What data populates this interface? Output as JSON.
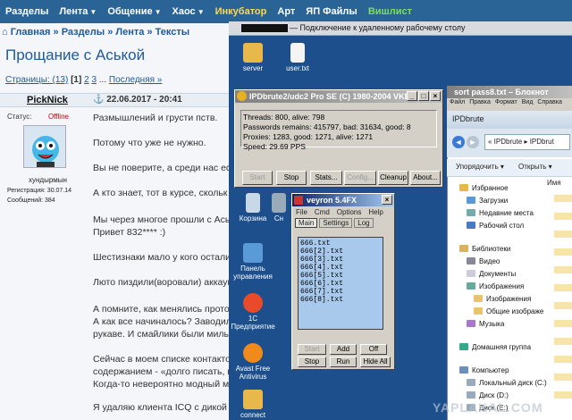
{
  "forum": {
    "nav": [
      {
        "label": "Разделы"
      },
      {
        "label": "Лента",
        "dropdown": true
      },
      {
        "label": "Общение",
        "dropdown": true
      },
      {
        "label": "Хаос",
        "dropdown": true
      },
      {
        "label": "Инкубатор"
      },
      {
        "label": "Арт"
      },
      {
        "label": "ЯП Файлы"
      },
      {
        "label": "Вишлист"
      }
    ],
    "breadcrumb": {
      "home": "Главная",
      "sep": "»",
      "items": [
        "Разделы",
        "Лента",
        "Тексты"
      ]
    },
    "title": "Прощание с Аськой",
    "pager": {
      "label": "Страницы: (13)",
      "current": "[1]",
      "pages": [
        "2",
        "3"
      ],
      "ellipsis": "...",
      "last": "Последняя »"
    },
    "post": {
      "author": "PickNick",
      "date": "22.06.2017 - 20:41",
      "status_label": "Статус:",
      "status_value": "Offline",
      "avatar_name": "хундырмын",
      "registered": "Регистрация: 30.07.14",
      "messages": "Сообщений: 384",
      "lines": [
        "Размышлений и грусти пств.",
        "Потому что уже не нужно.",
        "Вы не поверите, а среди нас ест",
        "А кто знает, тот в курсе, скольк",
        "Мы через многое прошли с Аськ",
        "Привет 832**** :)",
        "Шестизнаки мало у кого осталис",
        "Люто пиздили(воровали) аккаун",
        "А помните, как менялись протоК",
        "А как все начиналось? Заводил",
        "рукаве. И смайлики были милые",
        "Сейчас в моем списке контактов",
        "содержанием - «долго писать, по",
        "Когда-то невероятно модный ме",
        "Я удаляю клиента ICQ с дикой т"
      ]
    }
  },
  "remote": {
    "title": "Подключение к удаленному рабочему столу",
    "icons": [
      {
        "label": "server"
      },
      {
        "label": "user.txt"
      },
      {
        "label": "Корзина"
      },
      {
        "label": "Панель управления"
      },
      {
        "label": "1С Предприятие"
      },
      {
        "label": "Avast Free Antivirus"
      },
      {
        "label": "connect"
      },
      {
        "label": "Сн"
      }
    ],
    "ipdbrute": {
      "title": "IPDbrute2/udc2 Pro SE (C) 1980-2004 VKE",
      "lines": [
        "Threads: 800, alive: 798",
        "Passwords remains: 415797, bad: 31634, good: 8",
        "Proxies: 1283, good: 1271, alive: 1271",
        "Speed: 29.69 PPS"
      ],
      "buttons": [
        "Start",
        "Stop",
        "Stats...",
        "Config...",
        "Cleanup",
        "About..."
      ]
    },
    "veyron": {
      "title": "veyron 5.4FX",
      "menu": [
        "File",
        "Cmd",
        "Options",
        "Help"
      ],
      "tabs": [
        "Main",
        "Settings",
        "Log"
      ],
      "items": [
        "666.txt",
        "666[2].txt",
        "666[3].txt",
        "666[4].txt",
        "666[5].txt",
        "666[6].txt",
        "666[7].txt",
        "666[8].txt"
      ],
      "buttons_row1": [
        "Start",
        "Add",
        "Off"
      ],
      "buttons_row2": [
        "Stop",
        "Run",
        "Hide All"
      ]
    },
    "notepad": {
      "title": "sort pass8.txt – Блокнот",
      "menu": [
        "Файл",
        "Правка",
        "Формат",
        "Вид",
        "Справка"
      ]
    },
    "explorer": {
      "title": "IPDbrute",
      "path": "« IPDbrute ▸ IPDbrut",
      "toolbar": [
        "Упорядочить ▾",
        "Открыть ▾"
      ],
      "col": "Имя",
      "items": [
        "Избранное",
        "Загрузки",
        "Недавние места",
        "Рабочий стол",
        "Библиотеки",
        "Видео",
        "Документы",
        "Изображения",
        "Изображения",
        "Общие изображе",
        "Музыка",
        "Домашняя группа",
        "Компьютер",
        "Локальный диск (C:)",
        "Диск (D:)",
        "Диск (E:)"
      ]
    },
    "watermark": "YAPLAKAL.COM"
  }
}
